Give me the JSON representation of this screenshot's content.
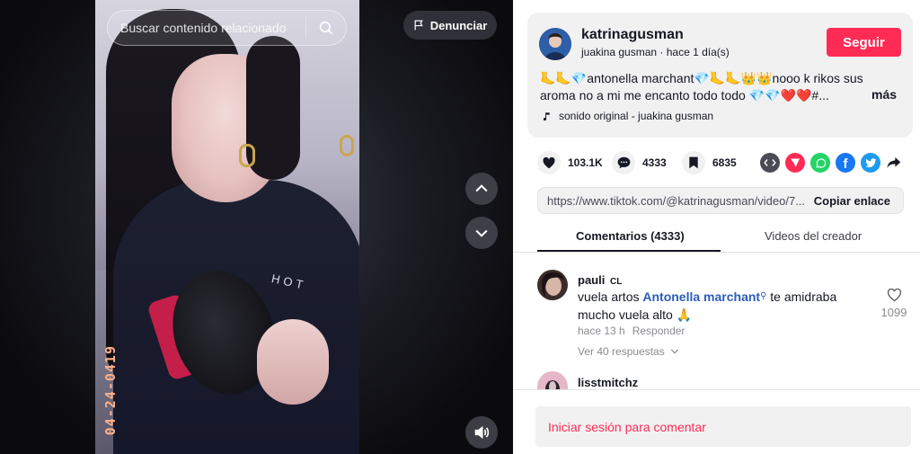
{
  "search": {
    "placeholder": "Buscar contenido relacionado"
  },
  "report_label": "Denunciar",
  "video": {
    "timestamp_overlay": "04-24-0419",
    "shirt_text": "HOT"
  },
  "author": {
    "username": "katrinagusman",
    "display_name": "juakina gusman",
    "time_ago": "hace 1 día(s)",
    "follow_label": "Seguir"
  },
  "description": "🦶🦶💎antonella marchant💎🦶🦶👑👑nooo k rikos sus aroma no a mi me encanto todo todo 💎💎❤️❤️#...",
  "more_label": "más",
  "music": "sonido original - juakina gusman",
  "stats": {
    "likes": "103.1K",
    "comments": "4333",
    "saves": "6835"
  },
  "share_icons": [
    "embed-icon",
    "send-icon",
    "whatsapp-icon",
    "facebook-icon",
    "twitter-icon",
    "share-arrow-icon"
  ],
  "link": {
    "url": "https://www.tiktok.com/@katrinagusman/video/7...",
    "copy_label": "Copiar enlace"
  },
  "tabs": [
    {
      "label": "Comentarios (4333)",
      "active": true
    },
    {
      "label": "Videos del creador",
      "active": false
    }
  ],
  "comments": [
    {
      "user": "pauli",
      "badge": "CL",
      "text_before": "vuela artos ",
      "mention": "Antonella marchant",
      "text_after": " te amidraba mucho vuela alto 🙏",
      "time": "hace 13 h",
      "reply_label": "Responder",
      "replies_label": "Ver 40 respuestas",
      "likes": "1099"
    },
    {
      "user": "lisstmitchz"
    }
  ],
  "login_label": "Iniciar sesión para comentar",
  "colors": {
    "brand": "#fe2c55",
    "mention": "#2b5db9"
  }
}
